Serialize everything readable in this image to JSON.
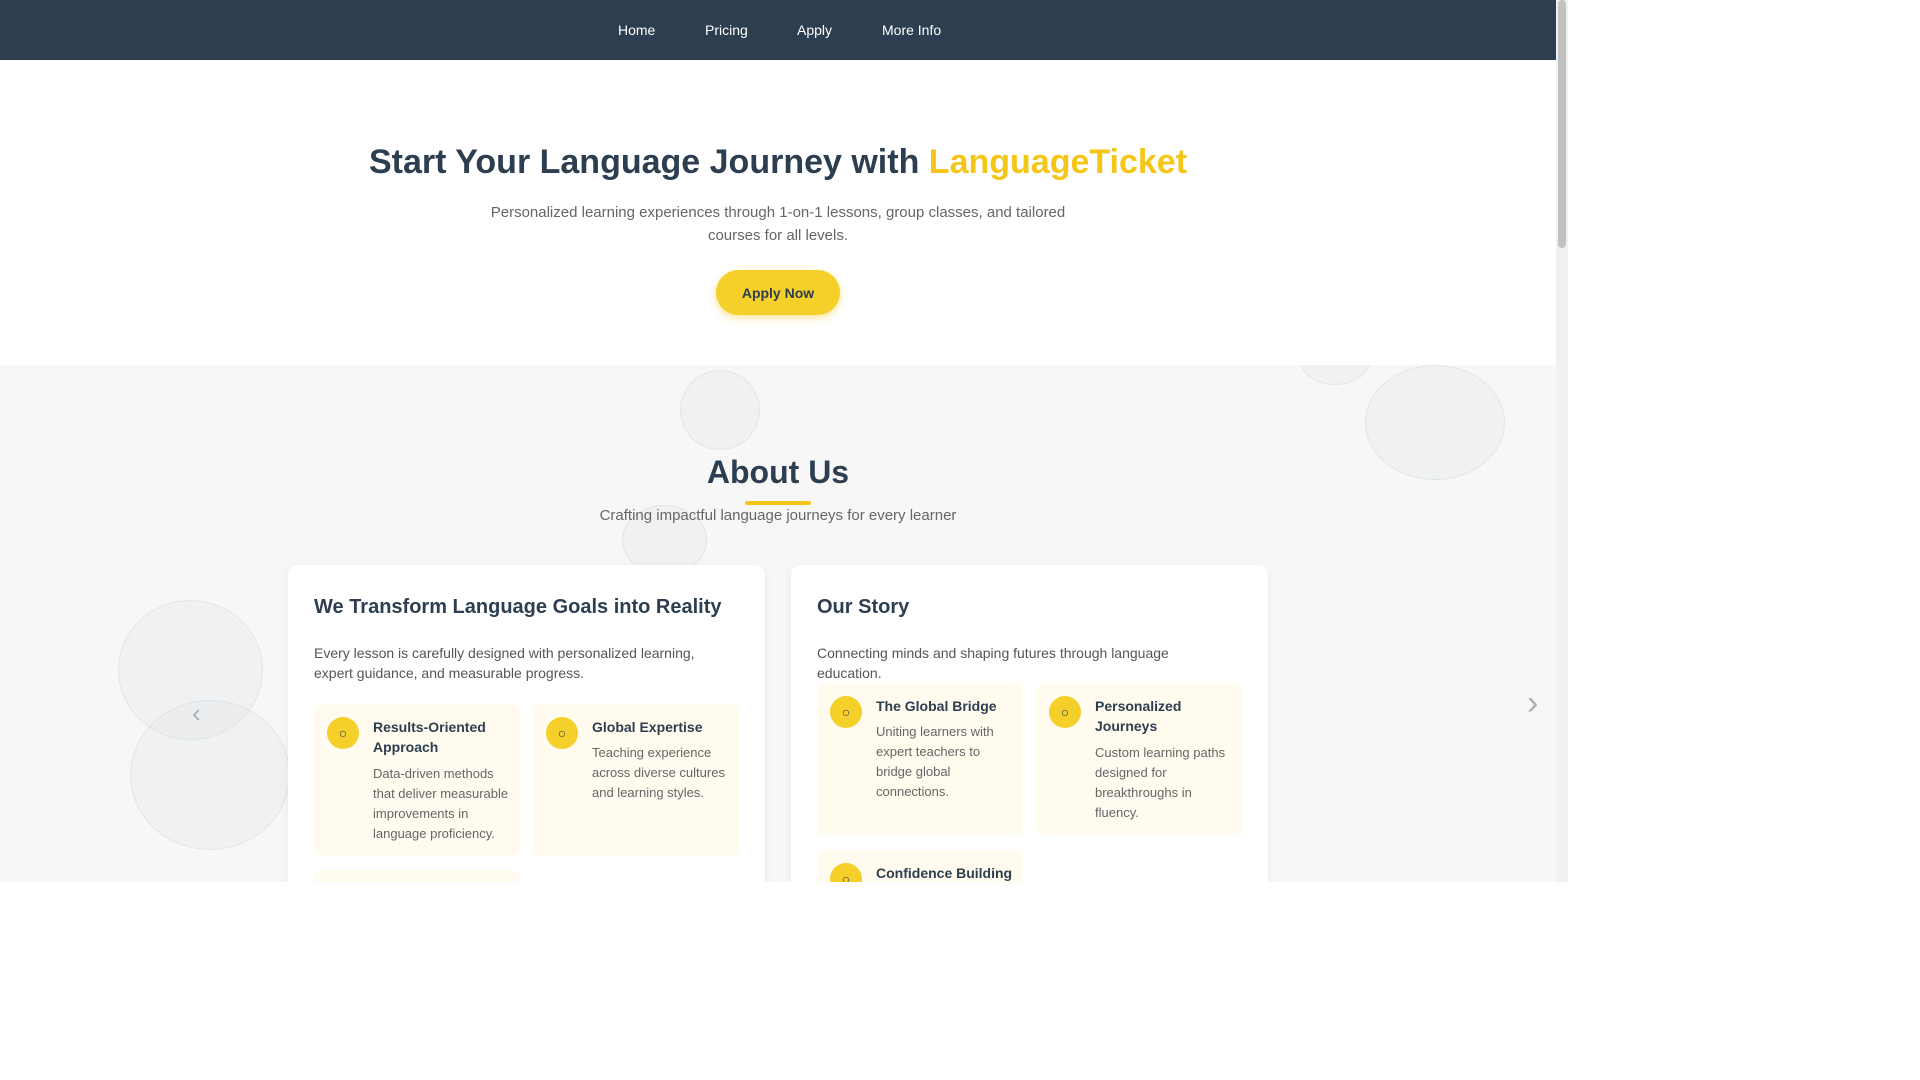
{
  "nav": {
    "items": [
      "Home",
      "Pricing",
      "Apply",
      "More Info"
    ]
  },
  "hero": {
    "title_prefix": "Start Your Language Journey with ",
    "title_brand": "LanguageTicket",
    "subtitle": "Personalized learning experiences through 1-on-1 lessons, group classes, and tailored courses for all levels.",
    "cta_label": "Apply Now"
  },
  "about": {
    "title": "About Us",
    "subtitle": "Crafting impactful language journeys for every learner",
    "left_card": {
      "title": "We Transform Language Goals into Reality",
      "text": "Every lesson is carefully designed with personalized learning, expert guidance, and measurable progress.",
      "features": [
        {
          "title": "Results-Oriented Approach",
          "text": "Data-driven methods that deliver measurable improvements in language proficiency."
        },
        {
          "title": "Global Expertise",
          "text": "Teaching experience across diverse cultures and learning styles."
        }
      ]
    },
    "right_card": {
      "title": "Our Story",
      "text": "Connecting minds and shaping futures through language education.",
      "features": [
        {
          "title": "The Global Bridge",
          "text": "Uniting learners with expert teachers to bridge global connections."
        },
        {
          "title": "Personalized Journeys",
          "text": "Custom learning paths designed for breakthroughs in fluency."
        },
        {
          "title": "Confidence Building",
          "text": ""
        }
      ]
    }
  },
  "icons": {
    "feature_icon": "feature-icon",
    "prev_arrow": "chevron-left-icon",
    "next_arrow": "chevron-right-icon"
  },
  "colors": {
    "nav_bg": "#2c3e50",
    "accent": "#f5c518",
    "button": "#f5d02a",
    "feature_bg": "#fffbef",
    "section_bg": "#f7f7f7"
  }
}
